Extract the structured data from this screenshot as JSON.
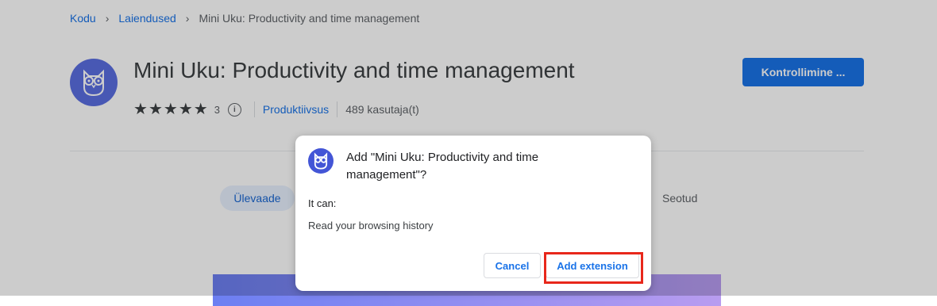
{
  "breadcrumb": {
    "home": "Kodu",
    "extensions": "Laiendused",
    "current": "Mini Uku: Productivity and time management"
  },
  "extension": {
    "name": "Mini Uku: Productivity and time management",
    "rating_stars": 5,
    "rating_count": "3",
    "category": "Produktiivsus",
    "users": "489 kasutaja(t)",
    "primary_button": "Kontrollimine ...",
    "logo_icon": "owl-icon"
  },
  "tabs": {
    "overview": "Ülevaade",
    "related": "Seotud"
  },
  "dialog": {
    "title": "Add \"Mini Uku: Productivity and time management\"?",
    "it_can": "It can:",
    "permission": "Read your browsing history",
    "cancel": "Cancel",
    "add": "Add extension"
  },
  "colors": {
    "accent": "#1a73e8",
    "highlight": "#e8271b",
    "logo_bg": "#5b6ee1"
  }
}
